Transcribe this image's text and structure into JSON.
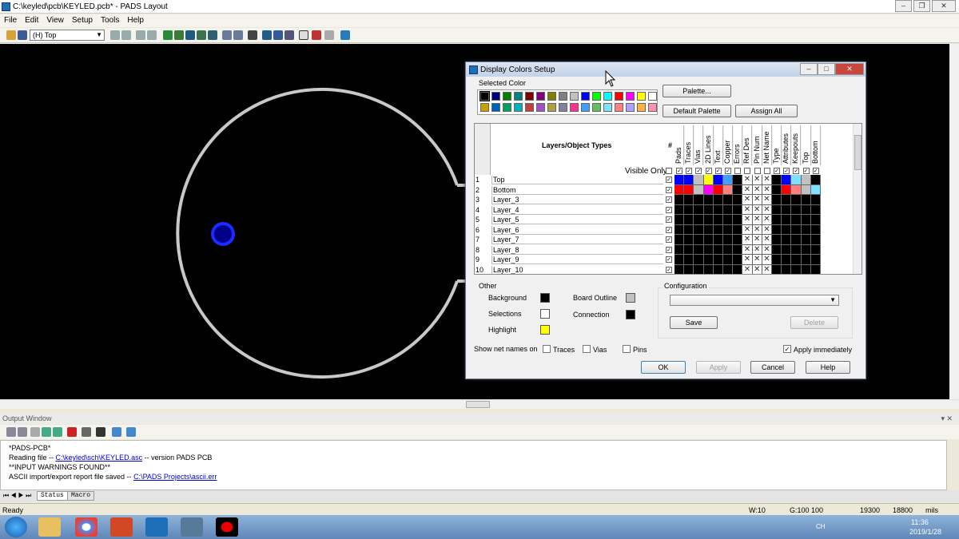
{
  "window": {
    "title": "C:\\keyled\\pcb\\KEYLED.pcb* - PADS Layout"
  },
  "menu": [
    "File",
    "Edit",
    "View",
    "Setup",
    "Tools",
    "Help"
  ],
  "toolbar": {
    "layer_select": "(H) Top"
  },
  "output": {
    "header": "Output Window",
    "lines": [
      {
        "text": "*PADS-PCB*"
      },
      {
        "prefix": "Reading file -- ",
        "link": "C:\\keyled\\sch\\KEYLED.asc",
        "suffix": "  -- version PADS PCB"
      },
      {
        "text": "**INPUT WARNINGS FOUND**"
      },
      {
        "prefix": "ASCII import/export report file saved -- ",
        "link": "C:\\PADS Projects\\ascii.err",
        "suffix": ""
      }
    ],
    "tabs": [
      "Status",
      "Macro"
    ]
  },
  "status": {
    "ready": "Ready",
    "width": "W:10",
    "grid": "G:100 100",
    "x": "19300",
    "y": "18800",
    "units": "mils"
  },
  "taskbar": {
    "time": "11:36",
    "date": "2019/1/28",
    "lang": "CH"
  },
  "dialog": {
    "title": "Display Colors Setup",
    "selected_color_label": "Selected Color",
    "palette_button": "Palette...",
    "default_palette_button": "Default Palette",
    "assign_all_button": "Assign All",
    "palette_row1": [
      "#000000",
      "#000080",
      "#008000",
      "#008080",
      "#800000",
      "#800080",
      "#808000",
      "#808080",
      "#c0c0c0",
      "#0000ff",
      "#00ff00",
      "#00ffff",
      "#ff0000",
      "#ff00ff",
      "#ffff00",
      "#ffffff"
    ],
    "palette_row2": [
      "#c8a000",
      "#0060c0",
      "#00a060",
      "#00b0c0",
      "#c04040",
      "#a050c0",
      "#b0a040",
      "#8080a0",
      "#ff3090",
      "#40a0ff",
      "#60c060",
      "#80e0ff",
      "#ff8080",
      "#b0a0ff",
      "#ffb040",
      "#ff90b0"
    ],
    "grid": {
      "layers_header": "Layers/Object Types",
      "hash_header": "#",
      "columns": [
        "Pads",
        "Traces",
        "Vias",
        "2D Lines",
        "Text",
        "Copper",
        "Errors",
        "Ref Des",
        "Pin Num",
        "Net Name",
        "Type",
        "Attributes",
        "Keepouts",
        "Top",
        "Bottom"
      ],
      "visible_only_label": "Visible Only",
      "rows": [
        {
          "num": "1",
          "name": "Top",
          "colors": [
            "#0000ff",
            "#0000ff",
            "#c0c0c0",
            "#ffff00",
            "#0000ff",
            "#40a0ff",
            "#000000",
            "x",
            "x",
            "x",
            "#000000",
            "#0000ff",
            "#80e0ff",
            "#c0c0c0",
            "#000000"
          ]
        },
        {
          "num": "2",
          "name": "Bottom",
          "colors": [
            "#ff0000",
            "#ff0000",
            "#c0c0c0",
            "#ff00ff",
            "#ff0000",
            "#ff8080",
            "#000000",
            "x",
            "x",
            "x",
            "#000000",
            "#ff0000",
            "#ff8080",
            "#c0c0c0",
            "#80e0ff"
          ]
        },
        {
          "num": "3",
          "name": "Layer_3"
        },
        {
          "num": "4",
          "name": "Layer_4"
        },
        {
          "num": "5",
          "name": "Layer_5"
        },
        {
          "num": "6",
          "name": "Layer_6"
        },
        {
          "num": "7",
          "name": "Layer_7"
        },
        {
          "num": "8",
          "name": "Layer_8"
        },
        {
          "num": "9",
          "name": "Layer_9"
        },
        {
          "num": "10",
          "name": "Layer_10"
        }
      ]
    },
    "other": {
      "label": "Other",
      "background": {
        "label": "Background",
        "color": "#000000"
      },
      "selections": {
        "label": "Selections",
        "color": "#ffffff"
      },
      "highlight": {
        "label": "Highlight",
        "color": "#ffff00"
      },
      "board_outline": {
        "label": "Board Outline",
        "color": "#c0c0c0"
      },
      "connection": {
        "label": "Connection",
        "color": "#000000"
      }
    },
    "configuration": {
      "label": "Configuration",
      "value": "",
      "save": "Save",
      "delete": "Delete"
    },
    "net_names": {
      "label": "Show net names on",
      "traces": "Traces",
      "vias": "Vias",
      "pins": "Pins"
    },
    "apply_immediately": "Apply immediately",
    "ok": "OK",
    "apply": "Apply",
    "cancel": "Cancel",
    "help": "Help"
  }
}
